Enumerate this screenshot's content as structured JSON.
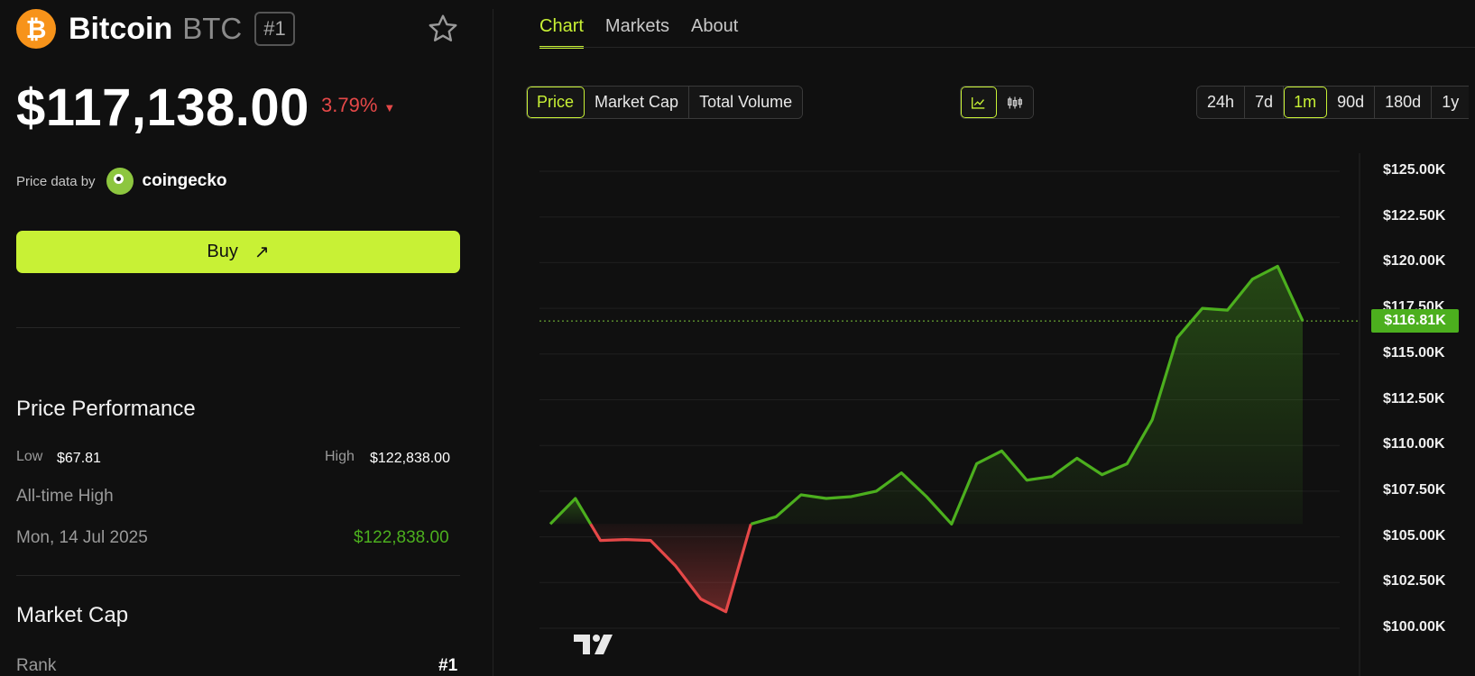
{
  "coin": {
    "name": "Bitcoin",
    "symbol": "BTC",
    "rank": "#1",
    "logo_glyph": "₿",
    "price": "$117,138.00",
    "change": "3.79%",
    "change_color": "#e54848",
    "change_direction_icon": "caret-down-icon"
  },
  "source": {
    "label": "Price data by",
    "brand": "coingecko"
  },
  "buy": {
    "label": "Buy",
    "icon": "arrow-up-right-icon"
  },
  "performance": {
    "title": "Price Performance",
    "low_label": "Low",
    "low_value": "$67.81",
    "high_label": "High",
    "high_value": "$122,838.00",
    "ath_label": "All-time High",
    "ath_date": "Mon, 14 Jul 2025",
    "ath_value": "$122,838.00"
  },
  "market_cap": {
    "title": "Market Cap",
    "rank_label": "Rank",
    "rank_value": "#1"
  },
  "tabs": [
    {
      "label": "Chart",
      "active": true
    },
    {
      "label": "Markets",
      "active": false
    },
    {
      "label": "About",
      "active": false
    }
  ],
  "metric_buttons": [
    {
      "label": "Price",
      "active": true
    },
    {
      "label": "Market Cap",
      "active": false
    },
    {
      "label": "Total Volume",
      "active": false
    }
  ],
  "chart_style_buttons": [
    {
      "icon": "line-chart-icon",
      "active": true
    },
    {
      "icon": "candlestick-icon",
      "active": false
    }
  ],
  "range_buttons": [
    {
      "label": "24h",
      "active": false
    },
    {
      "label": "7d",
      "active": false
    },
    {
      "label": "1m",
      "active": true
    },
    {
      "label": "90d",
      "active": false
    },
    {
      "label": "180d",
      "active": false
    },
    {
      "label": "1y",
      "active": false
    }
  ],
  "colors": {
    "accent": "#c8f135",
    "up": "#4caf1e",
    "down": "#e54848",
    "background": "#101010"
  },
  "chart_data": {
    "type": "line",
    "ylim": [
      98750,
      125000
    ],
    "y_ticks": [
      125000,
      122500,
      120000,
      117500,
      115000,
      112500,
      110000,
      107500,
      105000,
      102500,
      100000
    ],
    "y_tick_labels": [
      "$125.00K",
      "$122.50K",
      "$120.00K",
      "$117.50K",
      "$115.00K",
      "$112.50K",
      "$110.00K",
      "$107.50K",
      "$105.00K",
      "$102.50K",
      "$100.00K"
    ],
    "baseline": 105700,
    "current_value": 116810,
    "current_label": "$116.81K",
    "grid": true,
    "series": [
      {
        "values": [
          105700,
          107100,
          104800,
          104850,
          104800,
          103400,
          101600,
          100900,
          105700,
          106100,
          107300,
          107100,
          107200,
          107500,
          108500,
          107200,
          105700,
          109000,
          109700,
          108100,
          108300,
          109300,
          108400,
          109000,
          111400,
          115900,
          117500,
          117400,
          119100,
          119800,
          116810
        ]
      }
    ]
  }
}
